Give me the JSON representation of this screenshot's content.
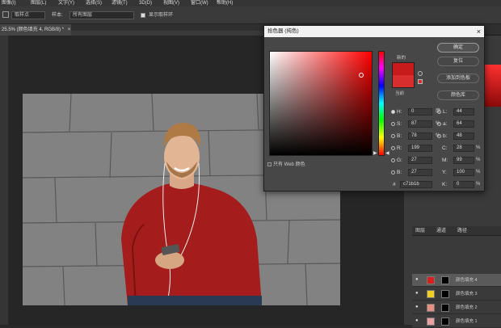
{
  "menubar": {
    "items": [
      "图像(I)",
      "图层(L)",
      "文字(Y)",
      "选择(S)",
      "滤镜(T)",
      "3D(D)",
      "视图(V)",
      "窗口(W)",
      "帮助(H)"
    ]
  },
  "options_bar": {
    "sample_size_value": "取样点",
    "sample_label": "样本:",
    "sample_value": "所有图层",
    "show_ring_label": "显示取样环"
  },
  "document_tab": {
    "label": "25.5% (颜色填充 4, RGB/8) *",
    "close": "×"
  },
  "color_picker": {
    "title": "拾色器 (纯色)",
    "close": "×",
    "new_label": "新的",
    "current_label": "当前",
    "new_color": "#c71b1b",
    "current_color": "#d92e2e",
    "buttons": {
      "ok": "确定",
      "cancel": "复位",
      "add_to_swatches": "添加到色板",
      "color_libraries": "颜色库"
    },
    "web_only_label": "只有 Web 颜色",
    "fields": {
      "H": {
        "label": "H:",
        "value": "0",
        "unit": "度"
      },
      "S": {
        "label": "S:",
        "value": "87",
        "unit": "%"
      },
      "B": {
        "label": "B:",
        "value": "78",
        "unit": "%"
      },
      "R": {
        "label": "R:",
        "value": "199"
      },
      "G": {
        "label": "G:",
        "value": "27"
      },
      "Bl": {
        "label": "B:",
        "value": "27"
      },
      "L": {
        "label": "L:",
        "value": "44"
      },
      "a": {
        "label": "a:",
        "value": "64"
      },
      "b": {
        "label": "b:",
        "value": "48"
      },
      "C": {
        "label": "C:",
        "value": "28",
        "unit": "%"
      },
      "M": {
        "label": "M:",
        "value": "99",
        "unit": "%"
      },
      "Y": {
        "label": "Y:",
        "value": "100",
        "unit": "%"
      },
      "K": {
        "label": "K:",
        "value": "0",
        "unit": "%"
      },
      "hex": {
        "label": "#",
        "value": "c71b1b"
      }
    }
  },
  "layers_panel": {
    "tabs": [
      "图层",
      "通道",
      "路径"
    ],
    "layers": [
      {
        "name": "颜色填充 4",
        "color": "#d91e1e"
      },
      {
        "name": "颜色填充 3",
        "color": "#f0d020"
      },
      {
        "name": "颜色填充 2",
        "color": "#e89080"
      },
      {
        "name": "颜色填充 1",
        "color": "#e8a0a0"
      }
    ]
  }
}
